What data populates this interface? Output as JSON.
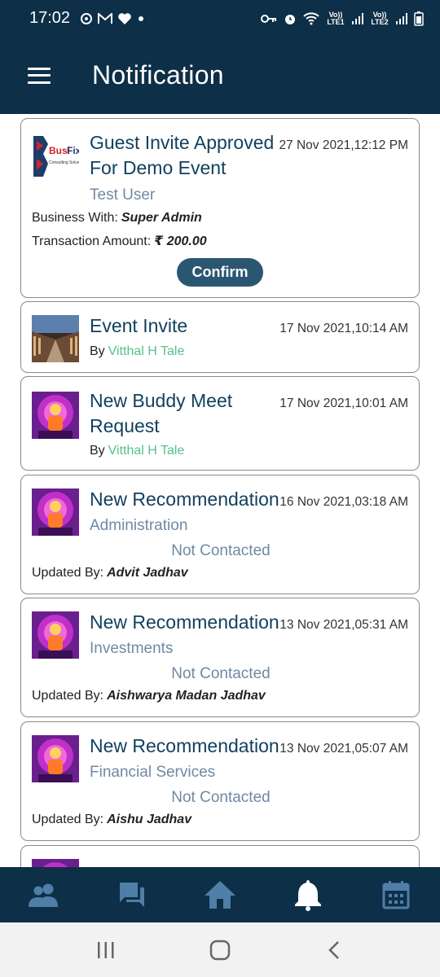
{
  "status_bar": {
    "time": "17:02",
    "lte1": "Vo)) LTE1",
    "lte2": "Vo)) LTE2"
  },
  "header": {
    "title": "Notification"
  },
  "notifications": [
    {
      "title_line1": "Guest Invite Approved",
      "title_line2": "For Demo Event",
      "date": "27 Nov 2021,12:12 PM",
      "subtitle": "Test User",
      "business_label": "Business With:",
      "business_value": "Super Admin",
      "amount_label": "Transaction Amount:",
      "amount_value": "₹ 200.00",
      "button": "Confirm",
      "logo_text": "BusiFix",
      "logo_tagline": "Consulting Solver"
    },
    {
      "title_line1": "Event Invite",
      "date": "17 Nov 2021,10:14 AM",
      "by_label": "By",
      "by_name": "Vitthal H Tale"
    },
    {
      "title_line1": "New Buddy Meet",
      "title_line2": "Request",
      "date": "17 Nov 2021,10:01 AM",
      "by_label": "By",
      "by_name": "Vitthal H Tale"
    },
    {
      "title_line1": "New Recommendation",
      "date": "16 Nov 2021,03:18 AM",
      "category": "Administration",
      "status": "Not Contacted",
      "updated_label": "Updated By:",
      "updated_by": "Advit Jadhav"
    },
    {
      "title_line1": "New Recommendation",
      "date": "13 Nov 2021,05:31 AM",
      "category": "Investments",
      "status": "Not Contacted",
      "updated_label": "Updated By:",
      "updated_by": "Aishwarya Madan Jadhav"
    },
    {
      "title_line1": "New Recommendation",
      "date": "13 Nov 2021,05:07 AM",
      "category": "Financial Services",
      "status": "Not Contacted",
      "updated_label": "Updated By:",
      "updated_by": "Aishu Jadhav"
    }
  ],
  "bottom_nav": [
    "people-icon",
    "forum-icon",
    "home-icon",
    "bell-icon",
    "calendar-icon"
  ],
  "colors": {
    "primary": "#0d2f47",
    "title_text": "#12405e",
    "muted_text": "#6f8aa3",
    "accent_green": "#56c18a",
    "button": "#2b5672"
  }
}
